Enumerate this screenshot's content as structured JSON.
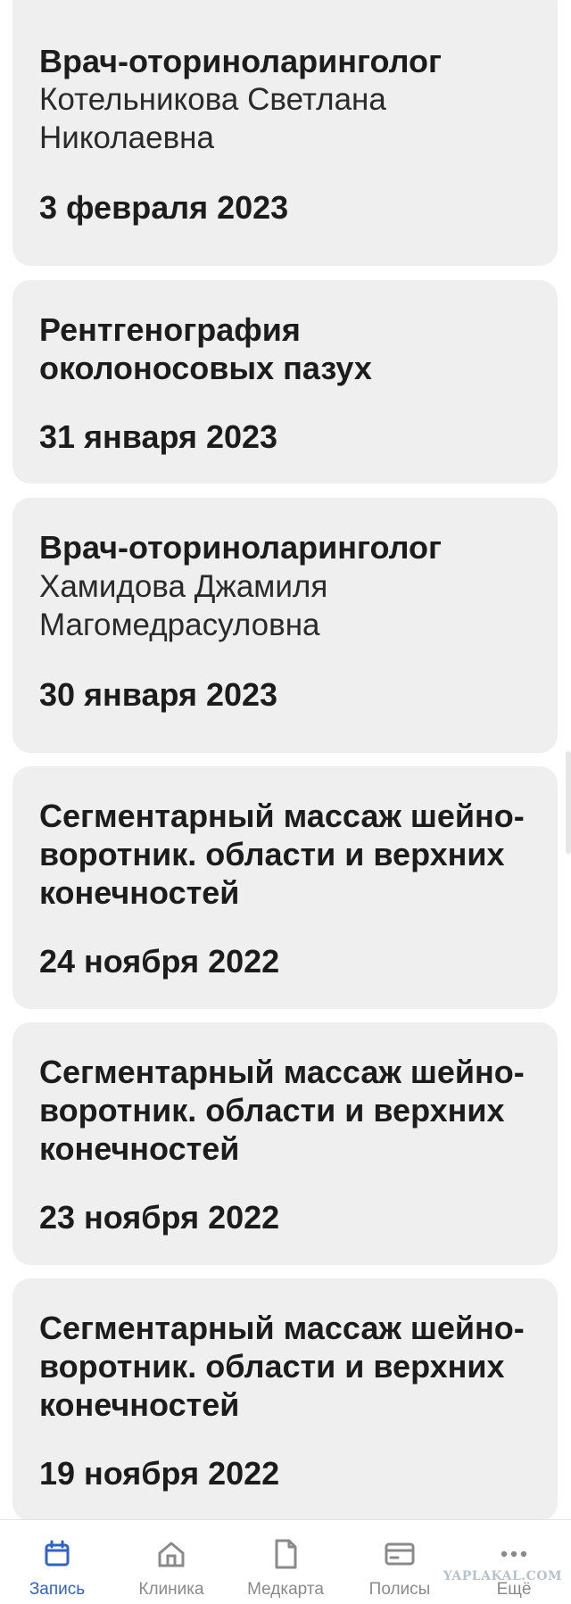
{
  "appointments": [
    {
      "title": "Врач-оториноларинголог",
      "doctor": "Котельникова Светлана Николаевна",
      "date": "3 февраля 2023"
    },
    {
      "title": "Рентгенография околоносовых пазух",
      "doctor": "",
      "date": "31 января 2023"
    },
    {
      "title": "Врач-оториноларинголог",
      "doctor": "Хамидова Джамиля Магомедрасуловна",
      "date": "30 января 2023"
    },
    {
      "title": "Сегментарный массаж шейно-воротник. области и верхних конечностей",
      "doctor": "",
      "date": "24 ноября 2022"
    },
    {
      "title": "Сегментарный массаж шейно-воротник. области и верхних конечностей",
      "doctor": "",
      "date": "23 ноября 2022"
    },
    {
      "title": "Сегментарный массаж шейно-воротник. области и верхних конечностей",
      "doctor": "",
      "date": "19 ноября 2022"
    }
  ],
  "tabbar": {
    "tabs": [
      {
        "label": "Запись",
        "icon": "calendar-icon",
        "active": true
      },
      {
        "label": "Клиника",
        "icon": "home-icon",
        "active": false
      },
      {
        "label": "Медкарта",
        "icon": "document-icon",
        "active": false
      },
      {
        "label": "Полисы",
        "icon": "card-icon",
        "active": false
      },
      {
        "label": "Ещё",
        "icon": "more-icon",
        "active": false
      }
    ]
  },
  "colors": {
    "active": "#2f63c8",
    "inactive": "#8a8a8a",
    "card_bg": "#efefef",
    "text": "#1c1c1c"
  },
  "watermark": "YAPLAKAL.COM"
}
